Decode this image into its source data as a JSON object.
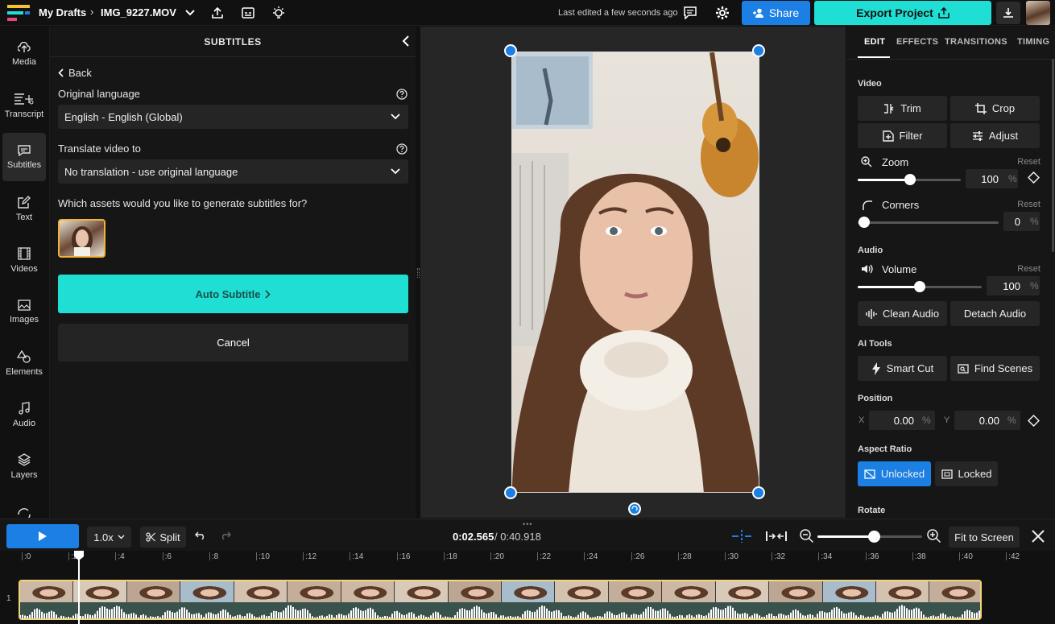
{
  "header": {
    "breadcrumb_root": "My Drafts",
    "file_name": "IMG_9227.MOV",
    "last_edited": "Last edited a few seconds ago",
    "share_label": "Share",
    "export_label": "Export Project"
  },
  "rail": {
    "items": [
      {
        "label": "Media",
        "icon": "upload-cloud-icon"
      },
      {
        "label": "Transcript",
        "icon": "transcript-icon"
      },
      {
        "label": "Subtitles",
        "icon": "subtitles-icon"
      },
      {
        "label": "Text",
        "icon": "text-edit-icon"
      },
      {
        "label": "Videos",
        "icon": "film-icon"
      },
      {
        "label": "Images",
        "icon": "image-icon"
      },
      {
        "label": "Elements",
        "icon": "shapes-icon"
      },
      {
        "label": "Audio",
        "icon": "music-note-icon"
      },
      {
        "label": "Layers",
        "icon": "layers-icon"
      }
    ]
  },
  "subtitles_panel": {
    "title": "SUBTITLES",
    "back_label": "Back",
    "original_language_label": "Original language",
    "original_language_value": "English - English (Global)",
    "translate_label": "Translate video to",
    "translate_value": "No translation - use original language",
    "assets_question": "Which assets would you like to generate subtitles for?",
    "auto_subtitle_label": "Auto Subtitle",
    "cancel_label": "Cancel"
  },
  "right_panel": {
    "tabs": [
      "EDIT",
      "EFFECTS",
      "TRANSITIONS",
      "TIMING"
    ],
    "video_section": "Video",
    "trim": "Trim",
    "crop": "Crop",
    "filter": "Filter",
    "adjust": "Adjust",
    "zoom_label": "Zoom",
    "zoom_value": "100",
    "corners_label": "Corners",
    "corners_value": "0",
    "reset": "Reset",
    "percent": "%",
    "audio_section": "Audio",
    "volume_label": "Volume",
    "volume_value": "100",
    "clean_audio": "Clean Audio",
    "detach_audio": "Detach Audio",
    "ai_section": "AI Tools",
    "smart_cut": "Smart Cut",
    "find_scenes": "Find Scenes",
    "position_section": "Position",
    "x_label": "X",
    "x_value": "0.00",
    "y_label": "Y",
    "y_value": "0.00",
    "aspect_section": "Aspect Ratio",
    "unlocked": "Unlocked",
    "locked": "Locked",
    "rotate_section": "Rotate",
    "accent_color": "#1b7fe3"
  },
  "timeline": {
    "speed": "1.0x",
    "split": "Split",
    "current_time": "0:02.565",
    "total_time": "/ 0:40.918",
    "fit_to_screen": "Fit to Screen",
    "track_number": "1",
    "ticks": [
      ":0",
      ":2",
      ":4",
      ":6",
      ":8",
      ":10",
      ":12",
      ":14",
      ":16",
      ":18",
      ":20",
      ":22",
      ":24",
      ":26",
      ":28",
      ":30",
      ":32",
      ":34",
      ":36",
      ":38",
      ":40",
      ":42"
    ]
  }
}
